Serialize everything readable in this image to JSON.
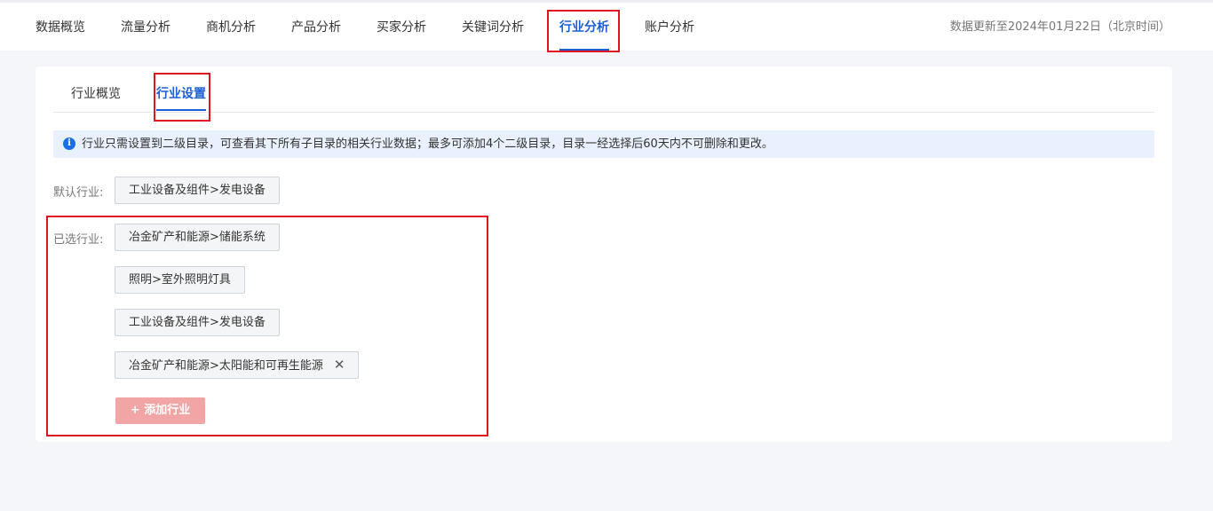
{
  "nav": {
    "tabs": [
      {
        "label": "数据概览"
      },
      {
        "label": "流量分析"
      },
      {
        "label": "商机分析"
      },
      {
        "label": "产品分析"
      },
      {
        "label": "买家分析"
      },
      {
        "label": "关键词分析"
      },
      {
        "label": "行业分析",
        "active": true
      },
      {
        "label": "账户分析"
      }
    ],
    "update_time": "数据更新至2024年01月22日（北京时间）"
  },
  "subtabs": [
    {
      "label": "行业概览"
    },
    {
      "label": "行业设置",
      "active": true
    }
  ],
  "notice": {
    "icon": "info-icon",
    "text": "行业只需设置到二级目录，可查看其下所有子目录的相关行业数据；最多可添加4个二级目录，目录一经选择后60天内不可删除和更改。"
  },
  "default_industry": {
    "label": "默认行业:",
    "value": "工业设备及组件>发电设备"
  },
  "selected_industries": {
    "label": "已选行业:",
    "items": [
      {
        "text": "冶金矿产和能源>储能系统"
      },
      {
        "text": "照明>室外照明灯具"
      },
      {
        "text": "工业设备及组件>发电设备"
      },
      {
        "text": "冶金矿产和能源>太阳能和可再生能源",
        "removable": true
      }
    ],
    "remove_glyph": "✕"
  },
  "add_button": {
    "label": "+ 添加行业"
  },
  "colors": {
    "accent": "#1a5fd6",
    "highlight": "#e0141e",
    "add_button_bg": "#f2a5a5",
    "notice_bg": "#e8f1fd"
  }
}
